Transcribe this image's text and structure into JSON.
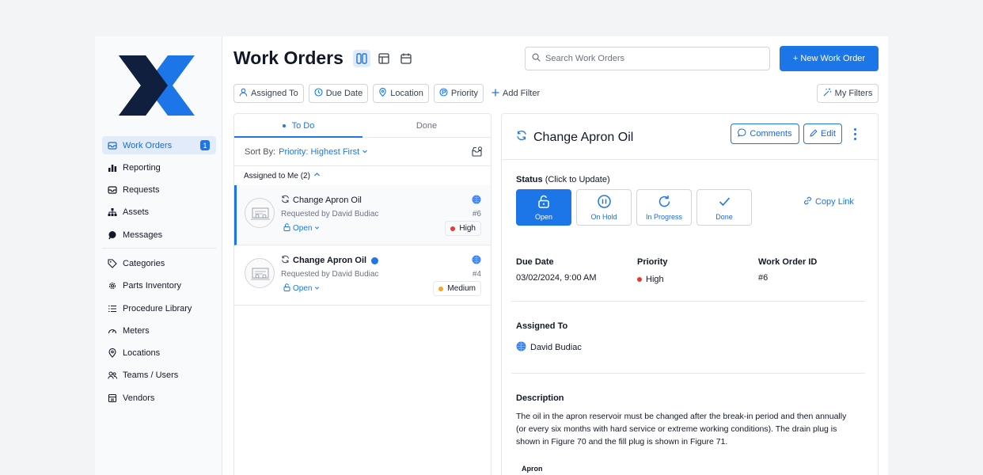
{
  "sidebar": {
    "items": [
      {
        "label": "Work Orders",
        "icon": "inbox-icon",
        "badge": "1",
        "active": true
      },
      {
        "label": "Reporting",
        "icon": "bar-chart-icon"
      },
      {
        "label": "Requests",
        "icon": "inbox-icon"
      },
      {
        "label": "Assets",
        "icon": "hierarchy-icon"
      },
      {
        "label": "Messages",
        "icon": "chat-icon"
      },
      {
        "label": "Categories",
        "icon": "tag-icon"
      },
      {
        "label": "Parts Inventory",
        "icon": "gear-icon"
      },
      {
        "label": "Procedure Library",
        "icon": "list-icon"
      },
      {
        "label": "Meters",
        "icon": "gauge-icon"
      },
      {
        "label": "Locations",
        "icon": "location-pin-icon"
      },
      {
        "label": "Teams / Users",
        "icon": "users-icon"
      },
      {
        "label": "Vendors",
        "icon": "vendor-icon"
      }
    ]
  },
  "header": {
    "title": "Work Orders",
    "search_placeholder": "Search Work Orders",
    "new_button": "+ New Work Order"
  },
  "filters": {
    "items": [
      "Assigned To",
      "Due Date",
      "Location",
      "Priority"
    ],
    "add_filter": "Add Filter",
    "my_filters": "My Filters"
  },
  "list": {
    "tabs": [
      "To Do",
      "Done"
    ],
    "sort_label": "Sort By:",
    "sort_value": "Priority: Highest First",
    "group_label": "Assigned to Me (2)",
    "orders": [
      {
        "title": "Change Apron Oil",
        "requested_by": "Requested by David Budiac",
        "status": "Open",
        "id": "#6",
        "priority": "High",
        "priority_color": "#e53935"
      },
      {
        "title": "Change Apron Oil",
        "requested_by": "Requested by David Budiac",
        "status": "Open",
        "id": "#4",
        "priority": "Medium",
        "priority_color": "#f5a623"
      }
    ]
  },
  "detail": {
    "title": "Change Apron Oil",
    "comments_button": "Comments",
    "edit_button": "Edit",
    "status_label": "Status",
    "status_hint": "(Click to Update)",
    "status_options": [
      "Open",
      "On Hold",
      "In Progress",
      "Done"
    ],
    "copy_link": "Copy Link",
    "due_date_label": "Due Date",
    "due_date": "03/02/2024, 9:00 AM",
    "priority_label": "Priority",
    "priority": "High",
    "wo_id_label": "Work Order ID",
    "wo_id": "#6",
    "assigned_label": "Assigned To",
    "assignee": "David Budiac",
    "description_label": "Description",
    "description": "The oil in the apron reservoir must be changed after the break-in period and then annually (or every six months with hard service or extreme working conditions). The drain plug is shown in Figure 70 and the fill plug is shown in Figure 71.",
    "apron_label": "Apron"
  },
  "colors": {
    "accent": "#1d76e8",
    "high": "#e53935",
    "medium": "#f5a623"
  }
}
